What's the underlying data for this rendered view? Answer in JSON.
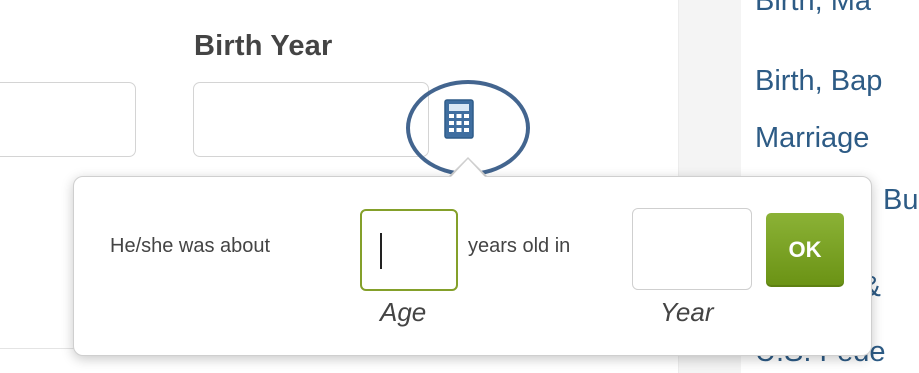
{
  "form": {
    "birth_year_label": "Birth Year",
    "birth_year_value": ""
  },
  "sidebar": {
    "links": [
      "Birth, Ma",
      "Birth, Bap",
      "Marriage",
      "Bu",
      "s &",
      "U.S. Fede"
    ]
  },
  "popover": {
    "prefix": "He/she was about",
    "middle": "years old in",
    "age_value": "",
    "year_value": "",
    "age_caption": "Age",
    "year_caption": "Year",
    "ok_label": "OK"
  },
  "icons": {
    "calculator": "calculator-icon"
  },
  "colors": {
    "link": "#2d5b85",
    "ok_button": "#7aa225",
    "age_focus_border": "#84a02a",
    "highlight_circle": "#43658f"
  }
}
